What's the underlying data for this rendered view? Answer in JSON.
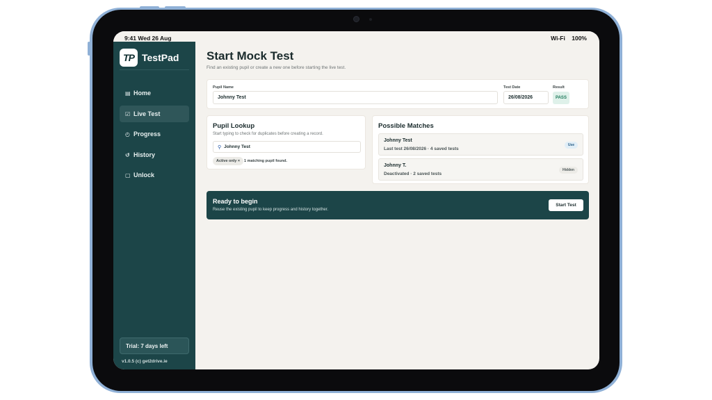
{
  "statusbar": {
    "time": "9:41  Wed 26 Aug",
    "wifi": "Wi-Fi",
    "battery": "100%"
  },
  "app": {
    "logo_text": "TP",
    "name": "TestPad"
  },
  "sidebar": {
    "items": [
      {
        "icon": "▤",
        "icon_name": "list-icon",
        "label": "Home"
      },
      {
        "icon": "☑",
        "icon_name": "checkbox-icon",
        "label": "Live Test"
      },
      {
        "icon": "◴",
        "icon_name": "clock-icon",
        "label": "Progress"
      },
      {
        "icon": "↺",
        "icon_name": "history-icon",
        "label": "History"
      },
      {
        "icon": "▢",
        "icon_name": "square-icon",
        "label": "Unlock"
      }
    ],
    "active_index": 1,
    "trial_label": "Trial: 7 days left",
    "version": "v1.0.5   (c) get2drive.ie"
  },
  "page": {
    "title": "Start Mock Test",
    "subtitle": "Find an existing pupil or create a new one before starting the live test."
  },
  "pupil_form": {
    "name_label": "Pupil Name",
    "name_value": "Johnny Test",
    "date_label": "Test Date",
    "date_value": "26/08/2026",
    "result_label": "Result",
    "result_value": "PASS"
  },
  "lookup": {
    "title": "Pupil Lookup",
    "subtitle": "Start typing to check for duplicates before creating a record.",
    "search_value": "Johnny Test",
    "chip_label": "Active only ×",
    "found_text": "1 matching pupil found."
  },
  "matches": {
    "title": "Possible Matches",
    "items": [
      {
        "name": "Johnny Test",
        "meta": "Last test 26/08/2026 · 4 saved tests",
        "badge": "Use"
      },
      {
        "name": "Johnny T.",
        "meta": "Deactivated · 2 saved tests",
        "badge": "Hidden"
      }
    ]
  },
  "ready": {
    "title": "Ready to begin",
    "subtitle": "Reuse the existing pupil to keep progress and history together.",
    "button": "Start Test"
  },
  "colors": {
    "sidebar_bg": "#1c4548",
    "page_bg": "#f4f2ee",
    "pass_bg": "#dff1ea",
    "pass_text": "#1f7a5c",
    "device_frame": "#8fb0d6"
  }
}
